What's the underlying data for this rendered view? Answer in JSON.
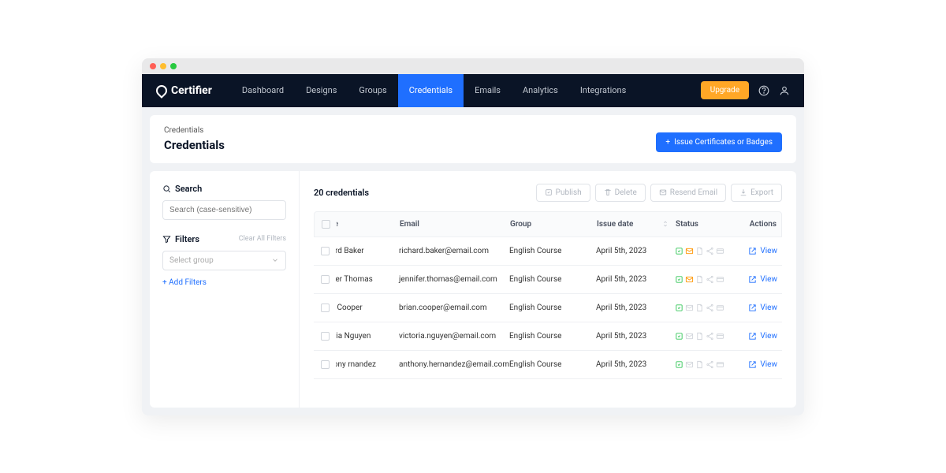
{
  "brand": "Certifier",
  "nav": {
    "items": [
      "Dashboard",
      "Designs",
      "Groups",
      "Credentials",
      "Emails",
      "Analytics",
      "Integrations"
    ],
    "activeIndex": 3,
    "upgrade": "Upgrade"
  },
  "header": {
    "breadcrumb": "Credentials",
    "title": "Credentials",
    "issue_btn": "Issue Certificates or Badges"
  },
  "sidebar": {
    "search_label": "Search",
    "search_placeholder": "Search (case-sensitive)",
    "filters_label": "Filters",
    "clear_filters": "Clear All Filters",
    "select_placeholder": "Select group",
    "add_filters": "+ Add Filters"
  },
  "main": {
    "count_label": "20 credentials",
    "actions": {
      "publish": "Publish",
      "delete": "Delete",
      "resend": "Resend Email",
      "export": "Export"
    },
    "columns": {
      "name": "me",
      "email": "Email",
      "group": "Group",
      "date": "Issue date",
      "status": "Status",
      "actions": "Actions"
    },
    "view_label": "View",
    "rows": [
      {
        "name": "hard Baker",
        "email": "richard.baker@email.com",
        "group": "English Course",
        "date": "April 5th, 2023"
      },
      {
        "name": "nifer Thomas",
        "email": "jennifer.thomas@email.com",
        "group": "English Course",
        "date": "April 5th, 2023"
      },
      {
        "name": "an Cooper",
        "email": "brian.cooper@email.com",
        "group": "English Course",
        "date": "April 5th, 2023"
      },
      {
        "name": "toria Nguyen",
        "email": "victoria.nguyen@email.com",
        "group": "English Course",
        "date": "April 5th, 2023"
      },
      {
        "name": "thony rnandez",
        "email": "anthony.hernandez@email.com",
        "group": "English Course",
        "date": "April 5th, 2023"
      }
    ]
  }
}
